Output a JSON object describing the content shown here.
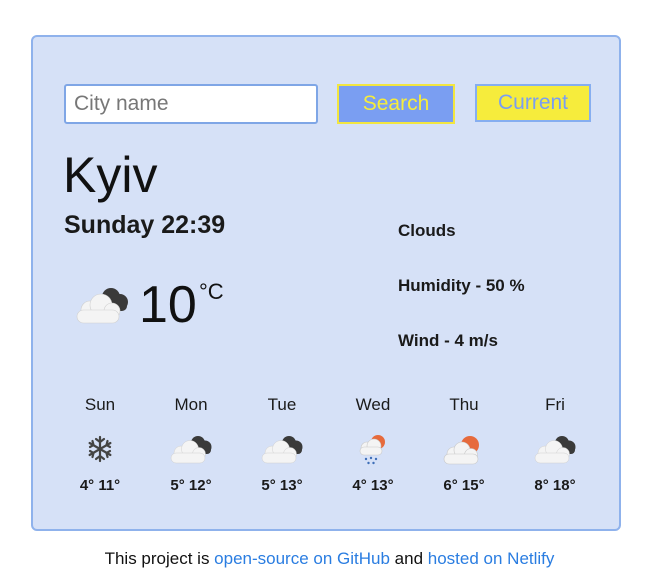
{
  "search": {
    "placeholder": "City name",
    "value": "",
    "search_label": "Search",
    "current_label": "Current"
  },
  "weather": {
    "city": "Kyiv",
    "datetime": "Sunday 22:39",
    "icon": "cloudy-icon",
    "temperature": "10",
    "unit": "°C",
    "description": "Clouds",
    "humidity": "Humidity - 50 %",
    "wind": "Wind - 4 m/s"
  },
  "forecast": [
    {
      "day": "Sun",
      "icon": "snowflake-icon",
      "temps": "4° 11°"
    },
    {
      "day": "Mon",
      "icon": "cloudy-icon",
      "temps": "5° 12°"
    },
    {
      "day": "Tue",
      "icon": "cloudy-icon",
      "temps": "5° 13°"
    },
    {
      "day": "Wed",
      "icon": "rain-sun-icon",
      "temps": "4° 13°"
    },
    {
      "day": "Thu",
      "icon": "partly-cloudy-icon",
      "temps": "6° 15°"
    },
    {
      "day": "Fri",
      "icon": "cloudy-icon",
      "temps": "8° 18°"
    }
  ],
  "footer": {
    "prefix": "This project is ",
    "github_link": "open-source on GitHub",
    "middle": " and ",
    "netlify_link": "hosted on Netlify"
  },
  "colors": {
    "card_bg": "#d6e1f7",
    "card_border": "#8fb2ec",
    "search_bg": "#7a9ef2",
    "yellow": "#f6ec3c",
    "link": "#2a7de1"
  }
}
